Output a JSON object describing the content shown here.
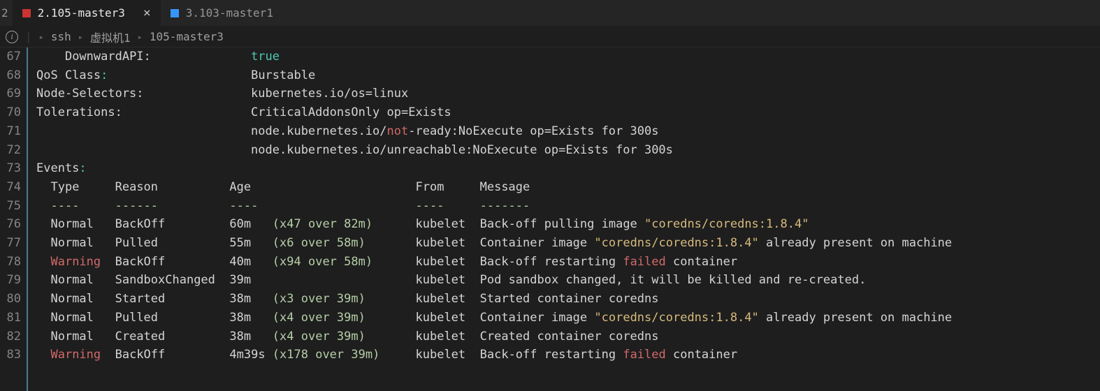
{
  "tabs": {
    "partial": "2",
    "active": {
      "label": "2.105-master3",
      "color": "red"
    },
    "inactive": {
      "label": "3.103-master1",
      "color": "blue"
    }
  },
  "breadcrumb": {
    "items": [
      "ssh",
      "虚拟机1",
      "105-master3"
    ]
  },
  "gutter": [
    "67",
    "68",
    "69",
    "70",
    "71",
    "72",
    "73",
    "74",
    "75",
    "76",
    "77",
    "78",
    "79",
    "80",
    "81",
    "82",
    "83"
  ],
  "lines": {
    "l67": {
      "key": "DownwardAPI",
      "val": "true"
    },
    "l68": {
      "key": "QoS Class",
      "val": "Burstable"
    },
    "l69": {
      "key": "Node-Selectors",
      "val": "kubernetes.io/os=linux"
    },
    "l70": {
      "key": "Tolerations",
      "val": "CriticalAddonsOnly op=Exists"
    },
    "l71": {
      "pre": "node.kubernetes.io/",
      "noth": "not",
      "post": "-ready:NoExecute op=Exists for 300s"
    },
    "l72": {
      "val": "node.kubernetes.io/unreachable:NoExecute op=Exists for 300s"
    },
    "l73": {
      "key": "Events"
    },
    "header": {
      "type": "Type",
      "reason": "Reason",
      "age": "Age",
      "from": "From",
      "message": "Message"
    },
    "dashes": {
      "type": "----",
      "reason": "------",
      "age": "----",
      "from": "----",
      "message": "-------"
    }
  },
  "events": [
    {
      "type": "Normal",
      "reason": "BackOff",
      "age1": "60m",
      "age2": "(x47 over 82m)",
      "from": "kubelet",
      "msg_pre": "Back-off pulling image ",
      "quoted": "\"coredns/coredns:1.8.4\"",
      "msg_post": ""
    },
    {
      "type": "Normal",
      "reason": "Pulled",
      "age1": "55m",
      "age2": "(x6 over 58m)",
      "from": "kubelet",
      "msg_pre": "Container image ",
      "quoted": "\"coredns/coredns:1.8.4\"",
      "msg_post": " already present on machine"
    },
    {
      "type": "Warning",
      "reason": "BackOff",
      "age1": "40m",
      "age2": "(x94 over 58m)",
      "from": "kubelet",
      "msg_pre": "Back-off restarting ",
      "failed": "failed",
      "msg_post": " container"
    },
    {
      "type": "Normal",
      "reason": "SandboxChanged",
      "age1": "39m",
      "age2": "",
      "from": "kubelet",
      "msg_pre": "Pod sandbox changed, it will be killed and re-created.",
      "msg_post": ""
    },
    {
      "type": "Normal",
      "reason": "Started",
      "age1": "38m",
      "age2": "(x3 over 39m)",
      "from": "kubelet",
      "msg_pre": "Started container coredns",
      "msg_post": ""
    },
    {
      "type": "Normal",
      "reason": "Pulled",
      "age1": "38m",
      "age2": "(x4 over 39m)",
      "from": "kubelet",
      "msg_pre": "Container image ",
      "quoted": "\"coredns/coredns:1.8.4\"",
      "msg_post": " already present on machine"
    },
    {
      "type": "Normal",
      "reason": "Created",
      "age1": "38m",
      "age2": "(x4 over 39m)",
      "from": "kubelet",
      "msg_pre": "Created container coredns",
      "msg_post": ""
    },
    {
      "type": "Warning",
      "reason": "BackOff",
      "age1": "4m39s",
      "age2": "(x178 over 39m)",
      "from": "kubelet",
      "msg_pre": "Back-off restarting ",
      "failed": "failed",
      "msg_post": " container"
    }
  ]
}
